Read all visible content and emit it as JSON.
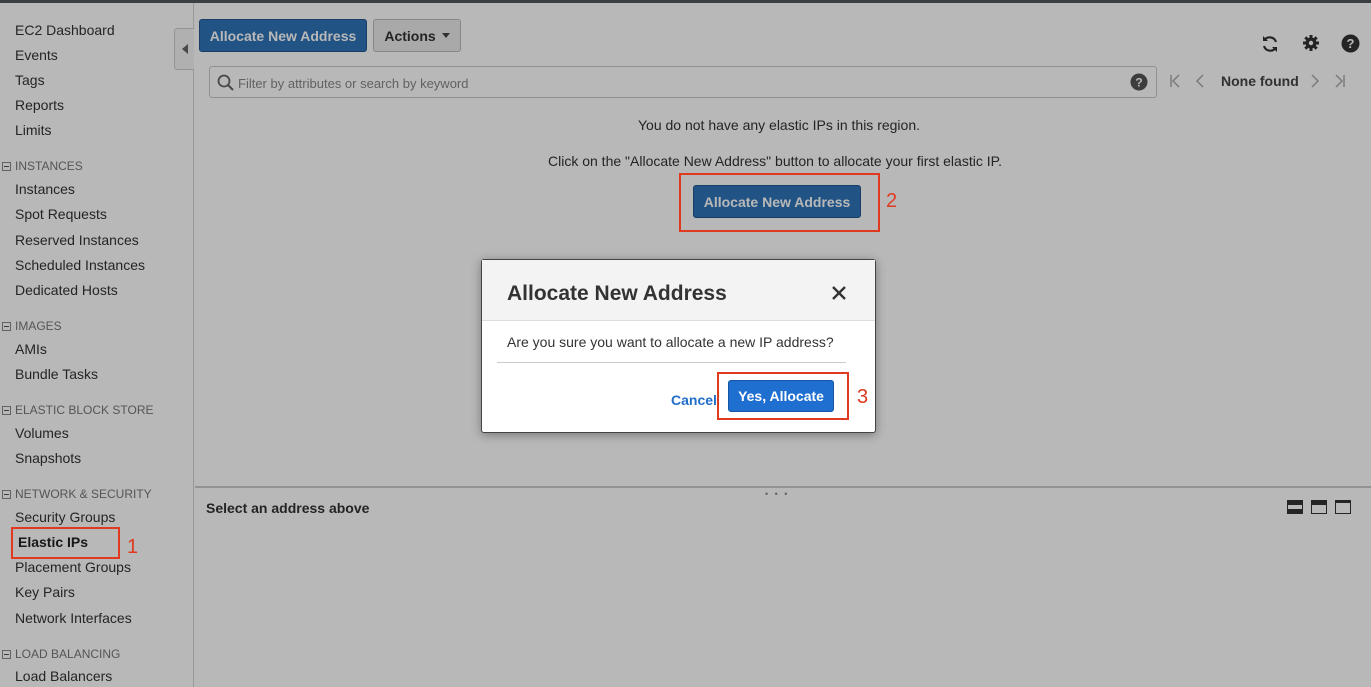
{
  "sidebar": {
    "top_items": [
      "EC2 Dashboard",
      "Events",
      "Tags",
      "Reports",
      "Limits"
    ],
    "sections": [
      {
        "title": "INSTANCES",
        "items": [
          "Instances",
          "Spot Requests",
          "Reserved Instances",
          "Scheduled Instances",
          "Dedicated Hosts"
        ]
      },
      {
        "title": "IMAGES",
        "items": [
          "AMIs",
          "Bundle Tasks"
        ]
      },
      {
        "title": "ELASTIC BLOCK STORE",
        "items": [
          "Volumes",
          "Snapshots"
        ]
      },
      {
        "title": "NETWORK & SECURITY",
        "items": [
          "Security Groups",
          "Elastic IPs",
          "Placement Groups",
          "Key Pairs",
          "Network Interfaces"
        ]
      },
      {
        "title": "LOAD BALANCING",
        "items": [
          "Load Balancers"
        ]
      }
    ],
    "active_item": "Elastic IPs"
  },
  "toolbar": {
    "allocate_label": "Allocate New Address",
    "actions_label": "Actions"
  },
  "filter": {
    "placeholder": "Filter by attributes or search by keyword"
  },
  "pager": {
    "status": "None found"
  },
  "empty_state": {
    "line1": "You do not have any elastic IPs in this region.",
    "line2": "Click on the \"Allocate New Address\" button to allocate your first elastic IP.",
    "button_label": "Allocate New Address"
  },
  "details_panel": {
    "title": "Select an address above"
  },
  "dialog": {
    "title": "Allocate New Address",
    "message": "Are you sure you want to allocate a new IP address?",
    "cancel_label": "Cancel",
    "confirm_label": "Yes, Allocate"
  },
  "annotations": [
    "1",
    "2",
    "3"
  ],
  "colors": {
    "primary_button": "#2f73b8",
    "annotation": "#e0391f",
    "link": "#1f6ec9"
  }
}
